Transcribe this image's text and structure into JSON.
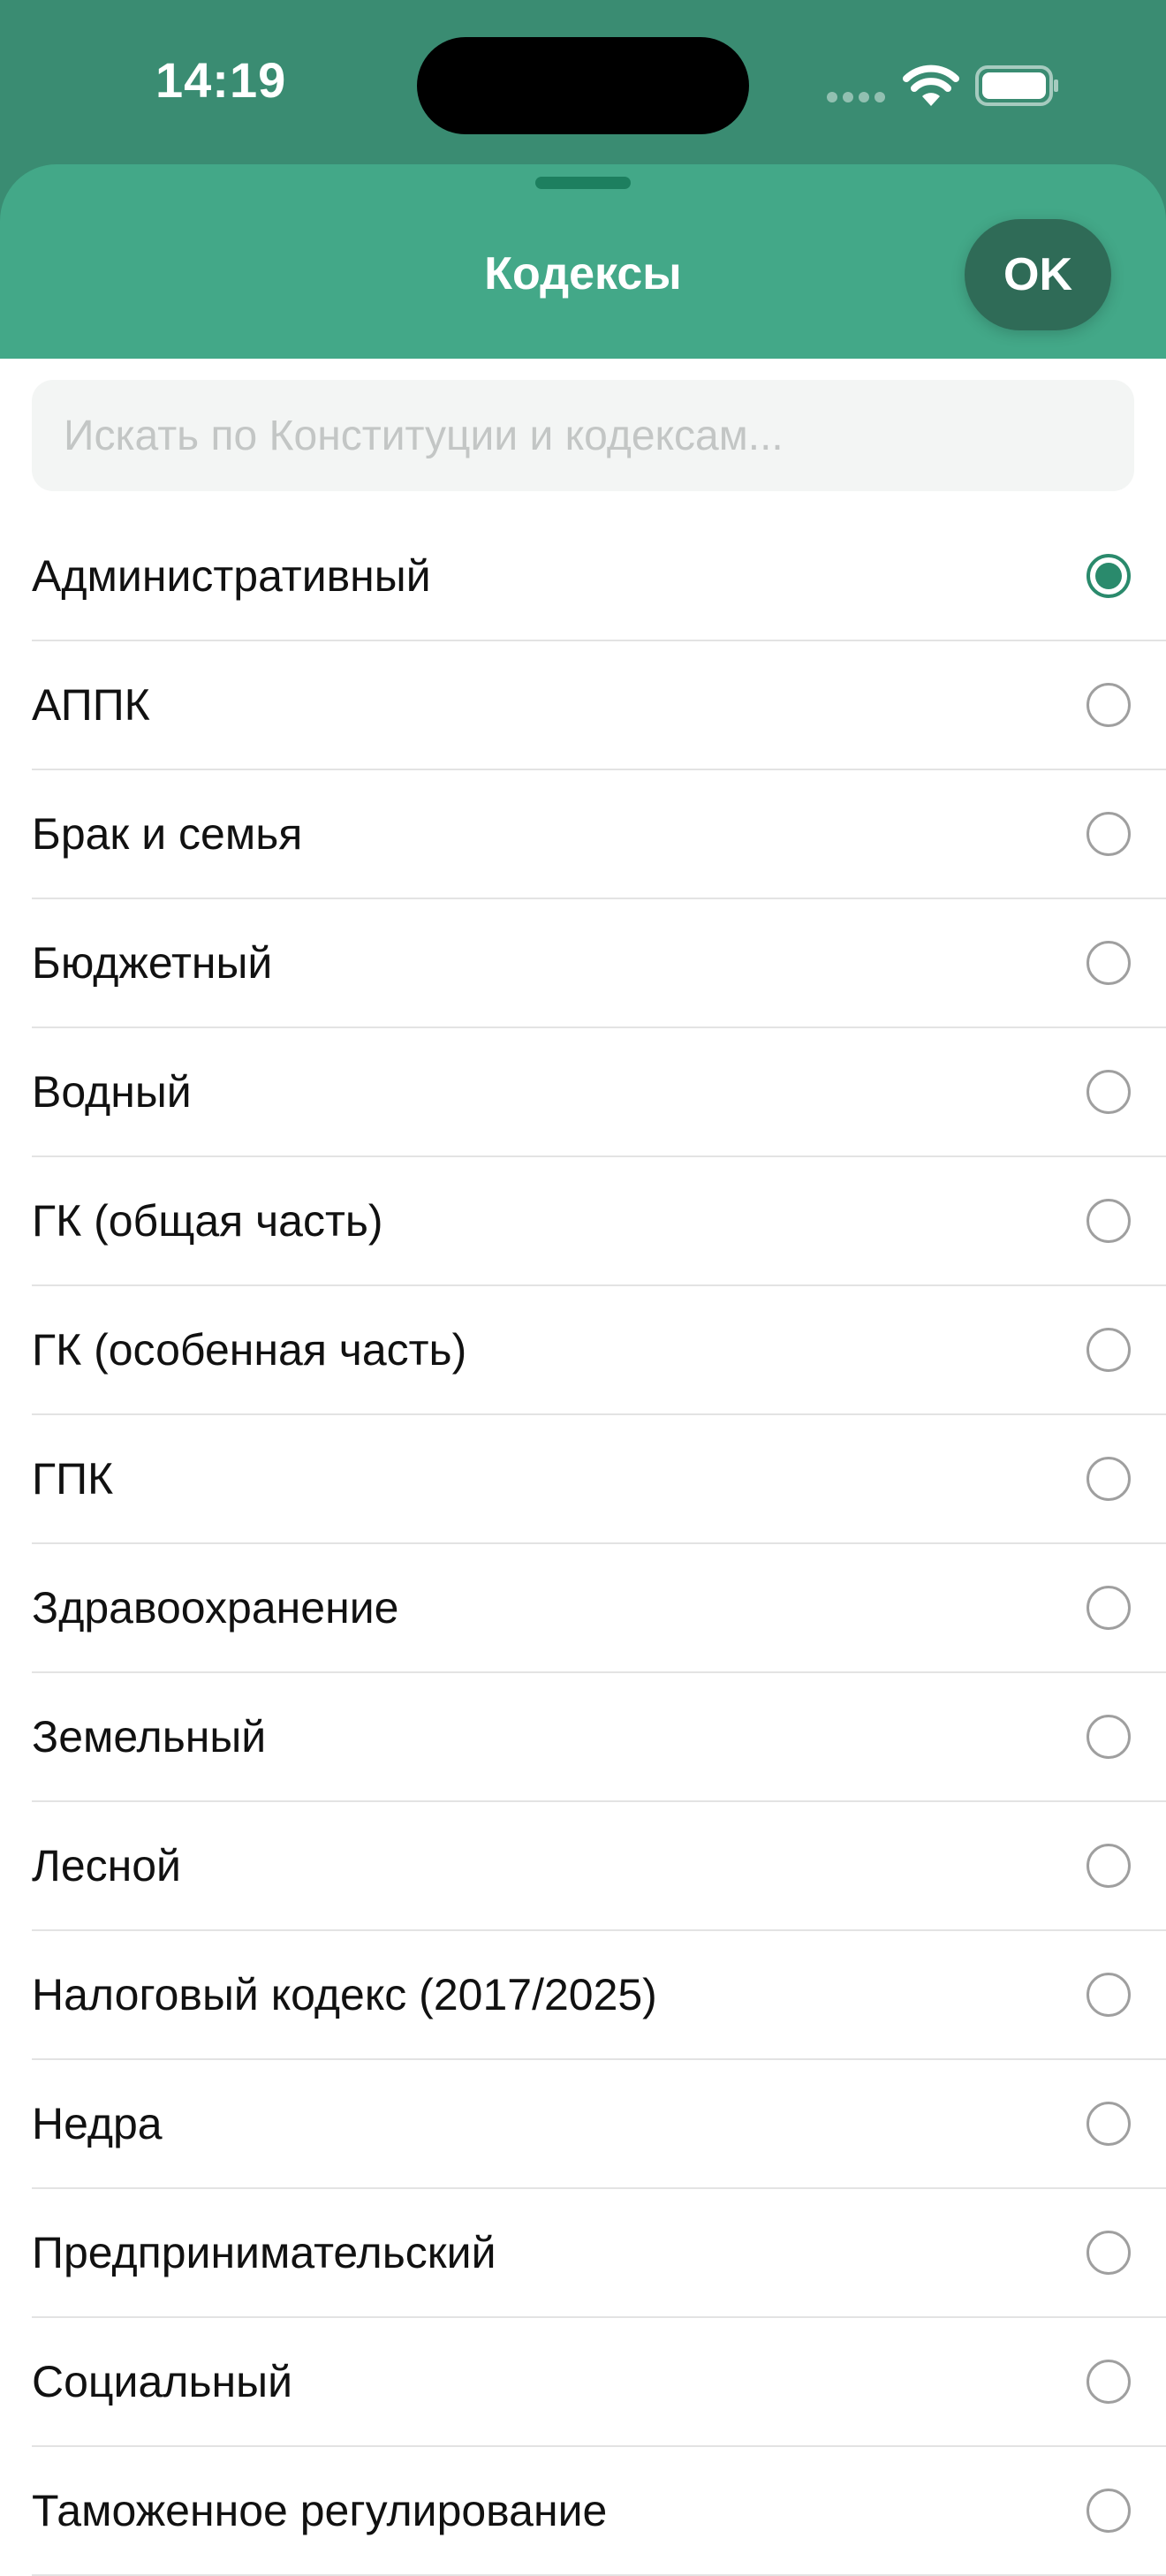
{
  "status_bar": {
    "time": "14:19"
  },
  "sheet": {
    "title": "Кодексы",
    "ok_label": "OK"
  },
  "search": {
    "placeholder": "Искать по Конституции и кодексам...",
    "value": ""
  },
  "colors": {
    "status_bar_bg": "#3a8c72",
    "header_bg": "#43a888",
    "ok_button_bg": "#2f6b57",
    "accent": "#2a8a6c"
  },
  "codes": [
    {
      "label": "Административный",
      "selected": true
    },
    {
      "label": "АППК",
      "selected": false
    },
    {
      "label": "Брак и семья",
      "selected": false
    },
    {
      "label": "Бюджетный",
      "selected": false
    },
    {
      "label": "Водный",
      "selected": false
    },
    {
      "label": "ГК (общая часть)",
      "selected": false
    },
    {
      "label": "ГК (особенная часть)",
      "selected": false
    },
    {
      "label": "ГПК",
      "selected": false
    },
    {
      "label": "Здравоохранение",
      "selected": false
    },
    {
      "label": "Земельный",
      "selected": false
    },
    {
      "label": "Лесной",
      "selected": false
    },
    {
      "label": "Налоговый кодекс (2017/2025)",
      "selected": false
    },
    {
      "label": "Недра",
      "selected": false
    },
    {
      "label": "Предпринимательский",
      "selected": false
    },
    {
      "label": "Социальный",
      "selected": false
    },
    {
      "label": "Таможенное регулирование",
      "selected": false
    }
  ]
}
